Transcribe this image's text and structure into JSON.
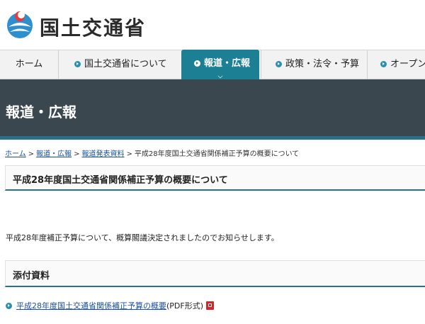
{
  "header": {
    "logo_text": "国土交通省"
  },
  "nav": {
    "items": [
      {
        "label": "ホーム"
      },
      {
        "label": "国土交通省について"
      },
      {
        "label": "報道・広報"
      },
      {
        "label": "政策・法令・予算"
      },
      {
        "label": "オープン"
      }
    ],
    "active_index": 2
  },
  "band": {
    "title": "報道・広報"
  },
  "breadcrumb": {
    "links": [
      "ホーム",
      "報道・広報",
      "報道発表資料"
    ],
    "separator": ">",
    "current": "平成28年度国土交通省関係補正予算の概要について"
  },
  "page": {
    "title": "平成28年度国土交通省関係補正予算の概要について",
    "lead": "平成28年度補正予算について、概算閣議決定されましたのでお知らせします。"
  },
  "attachments": {
    "heading": "添付資料",
    "items": [
      {
        "link": "平成28年度国土交通省関係補正予算の概要",
        "suffix": "(PDF形式)"
      }
    ]
  },
  "colors": {
    "accent": "#1d7f93",
    "band": "#3a474f",
    "link": "#1a4fa0",
    "pdf": "#d8232a"
  }
}
